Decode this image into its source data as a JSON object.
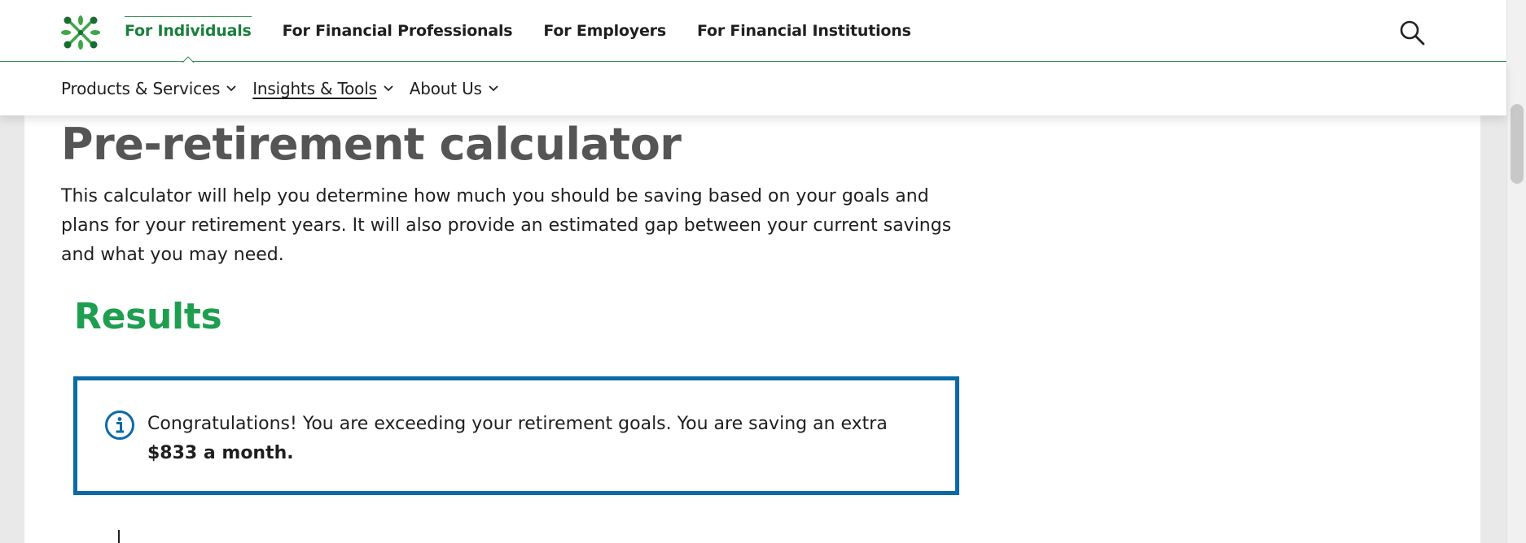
{
  "nav": {
    "tabs": [
      {
        "label": "For Individuals",
        "active": true
      },
      {
        "label": "For Financial Professionals",
        "active": false
      },
      {
        "label": "For Employers",
        "active": false
      },
      {
        "label": "For Financial Institutions",
        "active": false
      }
    ],
    "search_icon": "search-icon",
    "accent_color": "#2f8a4e"
  },
  "subnav": {
    "items": [
      {
        "label": "Products & Services",
        "underlined": false
      },
      {
        "label": "Insights & Tools",
        "underlined": true
      },
      {
        "label": "About Us",
        "underlined": false
      }
    ]
  },
  "main": {
    "title": "Pre-retirement calculator",
    "intro": "This calculator will help you determine how much you should be saving based on your goals and plans for your retirement years. It will also provide an estimated gap between your current savings and what you may need.",
    "results_heading": "Results",
    "notice": {
      "icon": "info-icon",
      "text": "Congratulations! You are exceeding your retirement goals. You are saving an extra",
      "highlight": "$833 a month.",
      "border_color": "#0a6aa8"
    }
  },
  "colors": {
    "results_green": "#1e9e4f",
    "title_gray": "#555555"
  }
}
